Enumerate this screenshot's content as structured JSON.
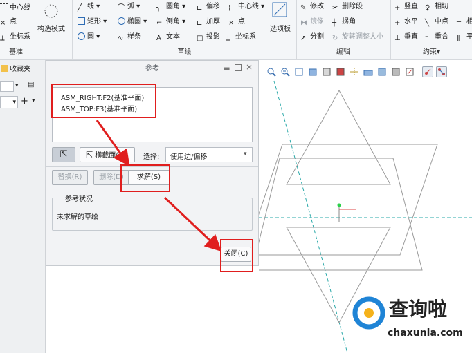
{
  "ribbon": {
    "items": {
      "centerline": "中心线",
      "point": "点",
      "coord_sys": "坐标系",
      "construction_mode": "构造模式",
      "line": "线",
      "arc": "弧",
      "fillet": "圆角",
      "offset": "偏移",
      "centerline2": "中心线",
      "modify": "修改",
      "delete_segment": "删除段",
      "vertical": "竖直",
      "tangent": "相切",
      "rectangle": "矩形",
      "ellipse": "椭圆",
      "chamfer": "倒角",
      "thicken": "加厚",
      "point2": "点",
      "mirror": "镜像",
      "corner": "拐角",
      "horizontal": "水平",
      "midpoint": "中点",
      "equal": "相",
      "circle": "圆",
      "spline": "样条",
      "text": "文本",
      "project": "投影",
      "coord_sys2": "坐标系",
      "palette": "选项板",
      "divide": "分割",
      "rotate_resize": "旋转调整大小",
      "perpendicular": "垂直",
      "coincident": "重合",
      "parallel": "平"
    },
    "groups": {
      "datum": "基准",
      "sketching": "草绘",
      "editing": "编辑",
      "constrain": "约束▾"
    }
  },
  "left": {
    "favorites": "收藏夹"
  },
  "dialog": {
    "title": "参考",
    "references": [
      "ASM_RIGHT:F2(基准平面)",
      "ASM_TOP:F3(基准平面)"
    ],
    "xsec_button": "横截面(X)",
    "select_label": "选择:",
    "select_value": "使用边/偏移",
    "replace": "替换(R)",
    "delete": "删除(D)",
    "solve": "求解(S)",
    "status_group": "参考状况",
    "status_text": "未求解的草绘",
    "close": "关闭(C)"
  },
  "watermark": {
    "brand": "查询啦",
    "url": "chaxunla.com"
  },
  "colors": {
    "highlight": "#e01e1e",
    "centerline": "#2aa9a9",
    "geometry": "#9a9a9a"
  }
}
